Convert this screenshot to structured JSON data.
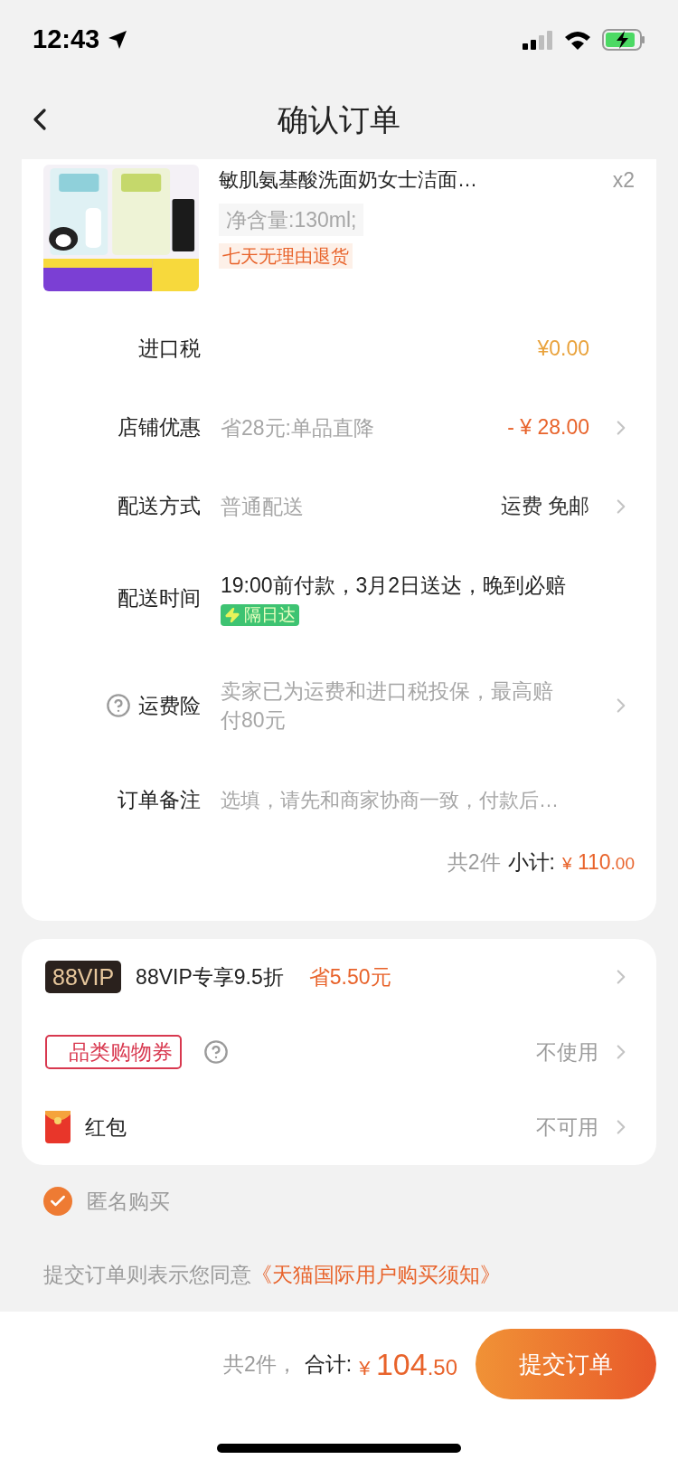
{
  "status_bar": {
    "time": "12:43"
  },
  "header": {
    "title": "确认订单"
  },
  "product": {
    "title": "敏肌氨基酸洗面奶女士洁面…",
    "quantity": "x2",
    "spec": "净含量:130ml;",
    "tag": "七天无理由退货"
  },
  "order_rows": [
    {
      "kind": "tax",
      "label": "进口税",
      "amount": "¥0.00",
      "chevron": false,
      "help": false
    },
    {
      "kind": "discount",
      "label": "店铺优惠",
      "detail": "省28元:单品直降",
      "amount": "- ¥ 28.00",
      "chevron": true,
      "help": false
    },
    {
      "kind": "shipping",
      "label": "配送方式",
      "detail": "普通配送",
      "amount": "运费 免邮",
      "chevron": true,
      "help": false
    },
    {
      "kind": "delivery",
      "label": "配送时间",
      "detail": "19:00前付款，3月2日送达，晚到必赔",
      "badge": "隔日达",
      "chevron": false,
      "help": false
    },
    {
      "kind": "insurance",
      "label": "运费险",
      "detail": "卖家已为运费和进口税投保，最高赔付80元",
      "chevron": true,
      "help": true
    },
    {
      "kind": "field",
      "label": "订单备注",
      "placeholder": "选填，请先和商家协商一致，付款后…",
      "chevron": false,
      "help": false
    }
  ],
  "subtotal": {
    "count": "共2件",
    "label": "小计:",
    "currency": "¥",
    "integer": "110",
    "decimal": ".00"
  },
  "benefits": [
    {
      "kind": "vip",
      "badge": "88VIP",
      "label": "88VIP专享9.5折",
      "saving": "省5.50元"
    },
    {
      "kind": "coupon",
      "badge": "品类购物券",
      "value": "不使用"
    },
    {
      "kind": "redpacket",
      "label": "红包",
      "value": "不可用"
    }
  ],
  "anonymous": {
    "label": "匿名购买",
    "checked": true
  },
  "agreement": {
    "text": "提交订单则表示您同意",
    "link": "《天猫国际用户购买须知》"
  },
  "footer": {
    "count": "共2件，",
    "label": "合计:",
    "currency": "¥",
    "integer": "104",
    "decimal": ".50",
    "button": "提交订单"
  }
}
